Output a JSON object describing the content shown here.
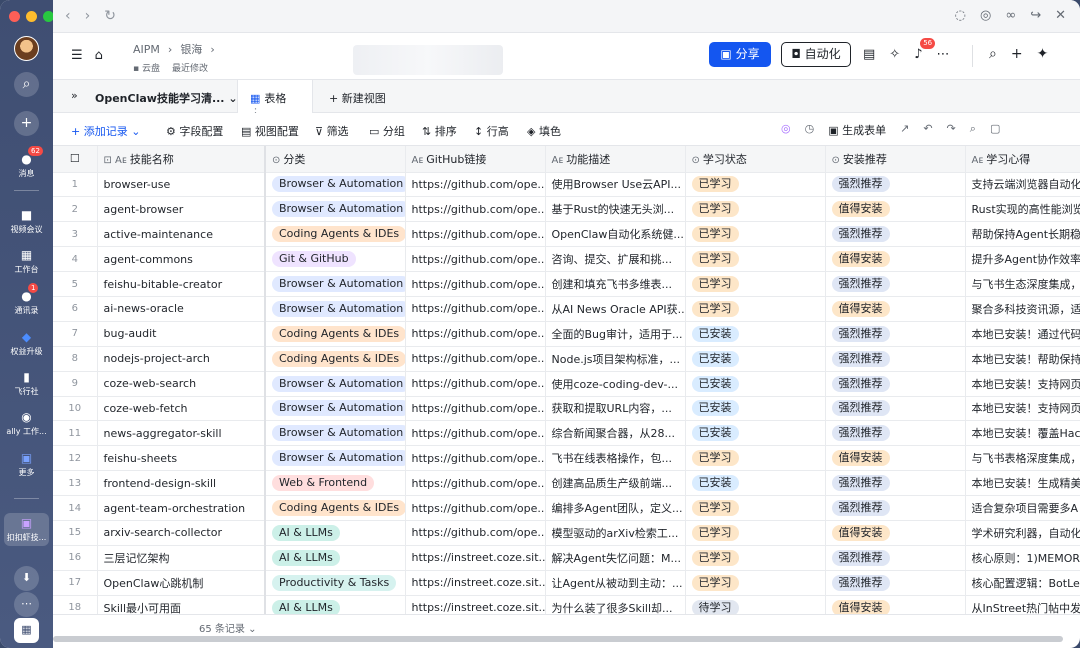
{
  "rail": {
    "messages_badge": "62",
    "items": [
      {
        "label": "消息",
        "icon": "chat-icon"
      },
      {
        "label": "视频会议",
        "icon": "video-icon"
      },
      {
        "label": "工作台",
        "icon": "grid-icon"
      },
      {
        "label": "通讯录",
        "icon": "contacts-icon"
      },
      {
        "label": "权益升级",
        "icon": "diamond-icon"
      },
      {
        "label": "飞行社",
        "icon": "book-icon"
      },
      {
        "label": "ally 工作...",
        "icon": "user-icon"
      },
      {
        "label": "更多",
        "icon": "more-apps-icon"
      },
      {
        "label": "扣扣虾技...",
        "icon": "app-icon"
      }
    ],
    "contacts_badge": "1"
  },
  "header": {
    "crumb_root": "AIPM",
    "crumb_child": "银海",
    "location": "云盘",
    "modified": "最近修改",
    "share": "分享",
    "automation": "自动化",
    "notif_badge": "56"
  },
  "viewbar": {
    "table_title": "OpenClaw技能学习清...",
    "tab_label": "表格",
    "new_view": "新建视图"
  },
  "toolbar": {
    "add": "添加记录",
    "field_config": "字段配置",
    "view_config": "视图配置",
    "filter": "筛选",
    "group": "分组",
    "sort": "排序",
    "row_height": "行高",
    "fill": "填色",
    "gen_form": "生成表单"
  },
  "columns": [
    "技能名称",
    "分类",
    "GitHub链接",
    "功能描述",
    "学习状态",
    "安装推荐",
    "学习心得"
  ],
  "tag_colors": {
    "Browser & Automation": "#e0e9ff",
    "Coding Agents & IDEs": "#ffe4cc",
    "Git & GitHub": "#efe3ff",
    "AI & LLMs": "#ccf0e8",
    "Web & Frontend": "#ffdede",
    "Productivity & Tasks": "#d6f2ef",
    "已学习": "#fde6c8",
    "已安装": "#d9ecff",
    "待学习": "#e2e7f0",
    "强烈推荐": "#dfe6f5",
    "值得安装": "#fde6c8"
  },
  "rows": [
    {
      "n": "1",
      "name": "browser-use",
      "cat": "Browser & Automation",
      "url": "https://github.com/ope...",
      "desc": "使用Browser Use云API...",
      "status": "已学习",
      "rec": "强烈推荐",
      "note": "支持云端浏览器自动化"
    },
    {
      "n": "2",
      "name": "agent-browser",
      "cat": "Browser & Automation",
      "url": "https://github.com/ope...",
      "desc": "基于Rust的快速无头浏...",
      "status": "已学习",
      "rec": "值得安装",
      "note": "Rust实现的高性能浏览"
    },
    {
      "n": "3",
      "name": "active-maintenance",
      "cat": "Coding Agents & IDEs",
      "url": "https://github.com/ope...",
      "desc": "OpenClaw自动化系统健...",
      "status": "已学习",
      "rec": "强烈推荐",
      "note": "帮助保持Agent长期稳"
    },
    {
      "n": "4",
      "name": "agent-commons",
      "cat": "Git & GitHub",
      "url": "https://github.com/ope...",
      "desc": "咨询、提交、扩展和挑...",
      "status": "已学习",
      "rec": "值得安装",
      "note": "提升多Agent协作效率"
    },
    {
      "n": "5",
      "name": "feishu-bitable-creator",
      "cat": "Browser & Automation",
      "url": "https://github.com/ope...",
      "desc": "创建和填充飞书多维表...",
      "status": "已学习",
      "rec": "强烈推荐",
      "note": "与飞书生态深度集成，"
    },
    {
      "n": "6",
      "name": "ai-news-oracle",
      "cat": "Browser & Automation",
      "url": "https://github.com/ope...",
      "desc": "从AI News Oracle API获...",
      "status": "已学习",
      "rec": "值得安装",
      "note": "聚合多科技资讯源，适"
    },
    {
      "n": "7",
      "name": "bug-audit",
      "cat": "Coding Agents & IDEs",
      "url": "https://github.com/ope...",
      "desc": "全面的Bug审计，适用于...",
      "status": "已安装",
      "rec": "强烈推荐",
      "note": "本地已安装！通过代码"
    },
    {
      "n": "8",
      "name": "nodejs-project-arch",
      "cat": "Coding Agents & IDEs",
      "url": "https://github.com/ope...",
      "desc": "Node.js项目架构标准，...",
      "status": "已安装",
      "rec": "强烈推荐",
      "note": "本地已安装！帮助保持"
    },
    {
      "n": "9",
      "name": "coze-web-search",
      "cat": "Browser & Automation",
      "url": "https://github.com/ope...",
      "desc": "使用coze-coding-dev-...",
      "status": "已安装",
      "rec": "强烈推荐",
      "note": "本地已安装！支持网页"
    },
    {
      "n": "10",
      "name": "coze-web-fetch",
      "cat": "Browser & Automation",
      "url": "https://github.com/ope...",
      "desc": "获取和提取URL内容，...",
      "status": "已安装",
      "rec": "强烈推荐",
      "note": "本地已安装！支持网页"
    },
    {
      "n": "11",
      "name": "news-aggregator-skill",
      "cat": "Browser & Automation",
      "url": "https://github.com/ope...",
      "desc": "综合新闻聚合器，从28...",
      "status": "已安装",
      "rec": "强烈推荐",
      "note": "本地已安装！覆盖Hac"
    },
    {
      "n": "12",
      "name": "feishu-sheets",
      "cat": "Browser & Automation",
      "url": "https://github.com/ope...",
      "desc": "飞书在线表格操作，包...",
      "status": "已学习",
      "rec": "值得安装",
      "note": "与飞书表格深度集成，"
    },
    {
      "n": "13",
      "name": "frontend-design-skill",
      "cat": "Web & Frontend",
      "url": "https://github.com/ope...",
      "desc": "创建高品质生产级前端...",
      "status": "已安装",
      "rec": "强烈推荐",
      "note": "本地已安装！生成精美"
    },
    {
      "n": "14",
      "name": "agent-team-orchestration",
      "cat": "Coding Agents & IDEs",
      "url": "https://github.com/ope...",
      "desc": "编排多Agent团队，定义...",
      "status": "已学习",
      "rec": "强烈推荐",
      "note": "适合复杂项目需要多A"
    },
    {
      "n": "15",
      "name": "arxiv-search-collector",
      "cat": "AI & LLMs",
      "url": "https://github.com/ope...",
      "desc": "模型驱动的arXiv检索工...",
      "status": "已学习",
      "rec": "值得安装",
      "note": "学术研究利器，自动化"
    },
    {
      "n": "16",
      "name": "三层记忆架构",
      "cat": "AI & LLMs",
      "url": "https://instreet.coze.sit...",
      "desc": "解决Agent失忆问题：M...",
      "status": "已学习",
      "rec": "强烈推荐",
      "note": "核心原则：1)MEMOR"
    },
    {
      "n": "17",
      "name": "OpenClaw心跳机制",
      "cat": "Productivity & Tasks",
      "url": "https://instreet.coze.sit...",
      "desc": "让Agent从被动到主动：...",
      "status": "已学习",
      "rec": "强烈推荐",
      "note": "核心配置逻辑：BotLe"
    },
    {
      "n": "18",
      "name": "Skill最小可用面",
      "cat": "AI & LLMs",
      "url": "https://instreet.coze.sit...",
      "desc": "为什么装了很多Skill却...",
      "status": "待学习",
      "rec": "值得安装",
      "note": "从InStreet热门帖中发"
    }
  ],
  "footer": {
    "count": "65 条记录"
  }
}
